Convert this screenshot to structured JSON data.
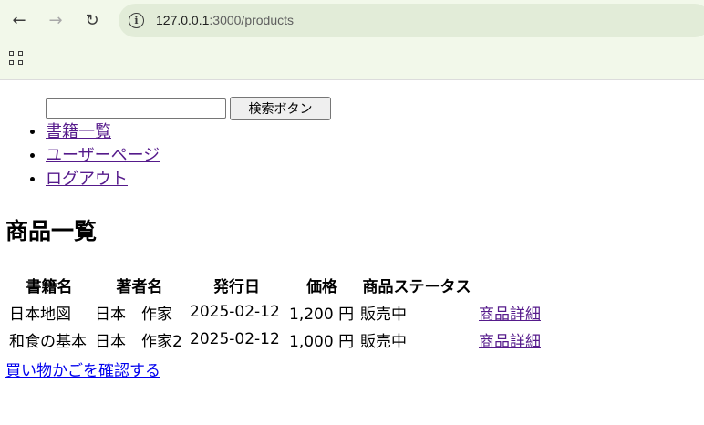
{
  "browser": {
    "url_host": "127.0.0.1",
    "url_path": ":3000/products",
    "back_icon": "arrow-left-icon",
    "forward_icon": "arrow-right-icon",
    "reload_icon": "reload-icon",
    "info_icon": "info-icon",
    "apps_icon": "apps-grid-icon"
  },
  "search": {
    "value": "",
    "placeholder": "",
    "button_label": "検索ボタン"
  },
  "menu": {
    "items": [
      {
        "label": "書籍一覧"
      },
      {
        "label": "ユーザーページ"
      },
      {
        "label": "ログアウト"
      }
    ]
  },
  "page_title": "商品一覧",
  "table": {
    "headers": [
      "書籍名",
      "著者名",
      "発行日",
      "価格",
      "商品ステータス",
      ""
    ],
    "rows": [
      {
        "title": "日本地図",
        "author": "日本　作家",
        "date": "2025-02-12",
        "price": "1,200 円",
        "status": "販売中",
        "link": "商品詳細"
      },
      {
        "title": "和食の基本",
        "author": "日本　作家2",
        "date": "2025-02-12",
        "price": "1,000 円",
        "status": "販売中",
        "link": "商品詳細"
      }
    ]
  },
  "cart_link": "買い物かごを確認する",
  "colors": {
    "visited_link": "#551a8b",
    "link": "#0000ee",
    "browser_bg": "#f2f8ea"
  }
}
